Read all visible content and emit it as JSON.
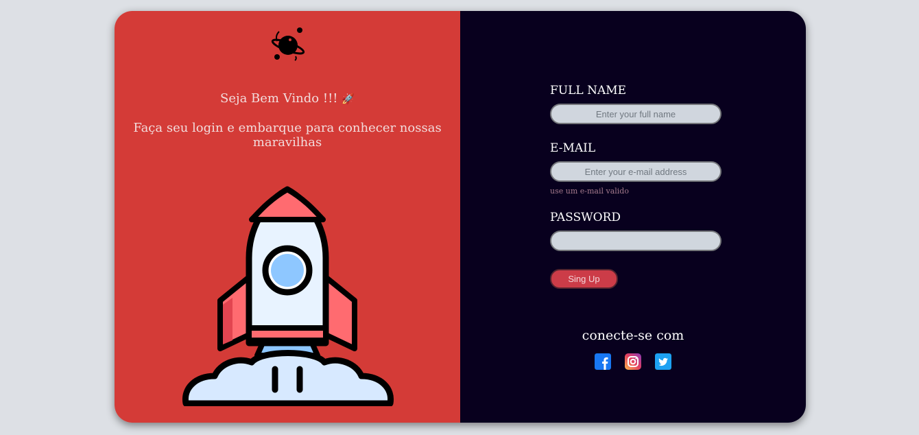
{
  "welcome": {
    "title": "Seja Bem Vindo !!!",
    "emoji": "🚀",
    "subtitle": "Faça seu login e embarque para conhecer nossas maravilhas"
  },
  "form": {
    "name_label": "FULL NAME",
    "name_placeholder": "Enter your full name",
    "email_label": "E-MAIL",
    "email_placeholder": "Enter your e-mail address",
    "email_hint": "use um e-mail valido",
    "password_label": "PASSWORD",
    "password_value": "",
    "submit_label": "Sing Up"
  },
  "social": {
    "title": "conecte-se com",
    "icons": [
      "facebook-icon",
      "instagram-icon",
      "twitter-icon"
    ]
  },
  "colors": {
    "left_panel": "#d43b37",
    "right_panel": "#08001e",
    "button": "#cc3c48",
    "input": "#d0d6de"
  }
}
